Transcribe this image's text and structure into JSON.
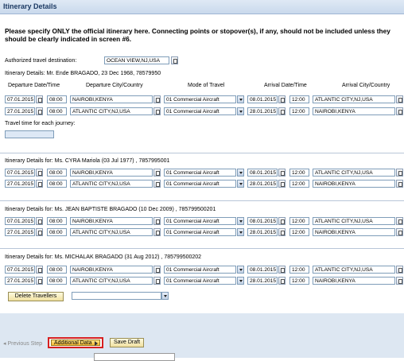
{
  "title": "Itinerary Details",
  "notice_line1": "Please specify ONLY the official itinerary here. Connecting points or stopover(s), if any, should not be included unless they",
  "notice_line2": "should be clearly indicated in screen #6.",
  "auth_dest_label": "Authorized travel destination:",
  "auth_dest_value": "OCEAN VIEW,NJ,USA",
  "headers": {
    "dep_date": "Departure Date/Time",
    "dep_city": "Departure City/Country",
    "mode": "Mode of Travel",
    "arr_date": "Arrival Date/Time",
    "arr_city": "Arrival City/Country"
  },
  "travel_time_label": "Travel time for each journey:",
  "sections": [
    {
      "heading": "Itinerary Details: Mr. Ende BRAGADO,  23 Dec 1968, 78579950",
      "rows": [
        {
          "dep_date": "07.01.2015",
          "dep_time": "08:00",
          "dep_city": "NAIROBI,KENYA",
          "mode": "01 Commercial Aircraft",
          "arr_date": "08.01.2015",
          "arr_time": "12:00",
          "arr_city": "ATLANTIC CITY,NJ,USA"
        },
        {
          "dep_date": "27.01.2015",
          "dep_time": "08:00",
          "dep_city": "ATLANTIC CITY,NJ,USA",
          "mode": "01 Commercial Aircraft",
          "arr_date": "28.01.2015",
          "arr_time": "12:00",
          "arr_city": "NAIROBI,KENYA"
        }
      ]
    },
    {
      "heading": "Itinerary Details for: Ms. CYRA Mariola (03 Jul 1977) , 7857995001",
      "rows": [
        {
          "dep_date": "07.01.2015",
          "dep_time": "08:00",
          "dep_city": "NAIROBI,KENYA",
          "mode": "01 Commercial Aircraft",
          "arr_date": "08.01.2015",
          "arr_time": "12:00",
          "arr_city": "ATLANTIC CITY,NJ,USA"
        },
        {
          "dep_date": "27.01.2015",
          "dep_time": "08:00",
          "dep_city": "ATLANTIC CITY,NJ,USA",
          "mode": "01 Commercial Aircraft",
          "arr_date": "28.01.2015",
          "arr_time": "12:00",
          "arr_city": "NAIROBI,KENYA"
        }
      ]
    },
    {
      "heading": "Itinerary Details for: Ms. JEAN BAPTISTE BRAGADO (10 Dec 2009) , 785799500201",
      "rows": [
        {
          "dep_date": "07.01.2015",
          "dep_time": "08:00",
          "dep_city": "NAIROBI,KENYA",
          "mode": "01 Commercial Aircraft",
          "arr_date": "08.01.2015",
          "arr_time": "12:00",
          "arr_city": "ATLANTIC CITY,NJ,USA"
        },
        {
          "dep_date": "27.01.2015",
          "dep_time": "08:00",
          "dep_city": "ATLANTIC CITY,NJ,USA",
          "mode": "01 Commercial Aircraft",
          "arr_date": "28.01.2015",
          "arr_time": "12:00",
          "arr_city": "NAIROBI,KENYA"
        }
      ]
    },
    {
      "heading": "Itinerary Details for: Ms. MICHALAK BRAGADO (31 Aug 2012) , 785799500202",
      "rows": [
        {
          "dep_date": "07.01.2015",
          "dep_time": "08:00",
          "dep_city": "NAIROBI,KENYA",
          "mode": "01 Commercial Aircraft",
          "arr_date": "08.01.2015",
          "arr_time": "12:00",
          "arr_city": "ATLANTIC CITY,NJ,USA"
        },
        {
          "dep_date": "27.01.2015",
          "dep_time": "08:00",
          "dep_city": "ATLANTIC CITY,NJ,USA",
          "mode": "01 Commercial Aircraft",
          "arr_date": "28.01.2015",
          "arr_time": "12:00",
          "arr_city": "NAIROBI,KENYA"
        }
      ]
    }
  ],
  "delete_travellers_label": "Delete Travellers",
  "footer": {
    "previous_step": "◂ Previous Step",
    "additional_data": "Additional Data",
    "save_draft": "Save Draft"
  },
  "colors": {
    "highlight_border": "#d62020",
    "title_text": "#1c3a63"
  }
}
